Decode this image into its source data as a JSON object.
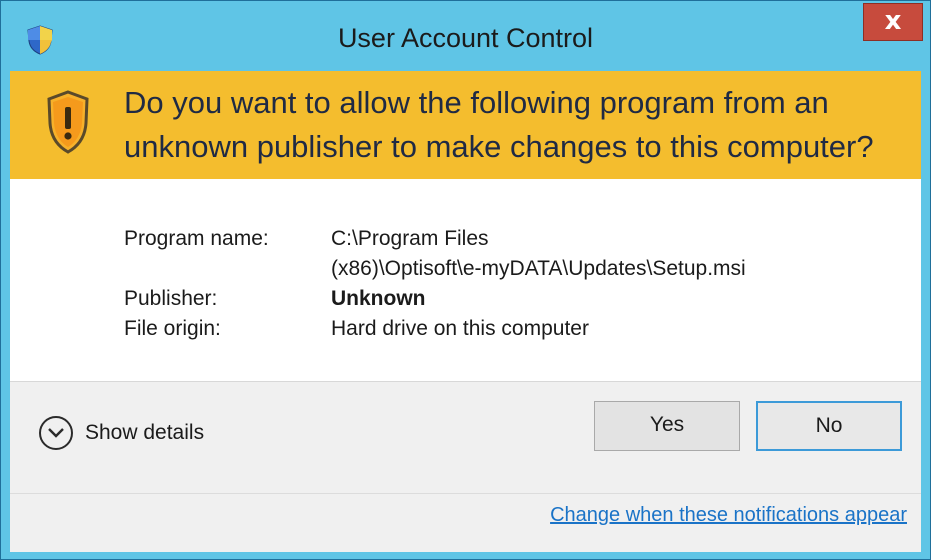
{
  "window": {
    "title": "User Account Control",
    "close_label": "x",
    "title_bar_color": "#5fc5e6",
    "banner_color": "#f4bd2e",
    "title_icon": "uac-shield-icon",
    "banner_icon": "warning-shield-icon"
  },
  "prompt": {
    "question_line1": "Do you want to allow the following program from an",
    "question_line2": "unknown publisher to make changes to this computer?"
  },
  "details": {
    "program_name_label": "Program name:",
    "program_name_line1": "C:\\Program Files",
    "program_name_line2": "(x86)\\Optisoft\\e-myDATA\\Updates\\Setup.msi",
    "publisher_label": "Publisher:",
    "publisher_value": "Unknown",
    "file_origin_label": "File origin:",
    "file_origin_value": "Hard drive on this computer"
  },
  "footer": {
    "show_details_label": "Show details",
    "show_details_icon": "chevron-down-icon",
    "yes_label": "Yes",
    "no_label": "No",
    "change_link_label": "Change when these notifications appear",
    "link_color": "#1a73c7"
  }
}
